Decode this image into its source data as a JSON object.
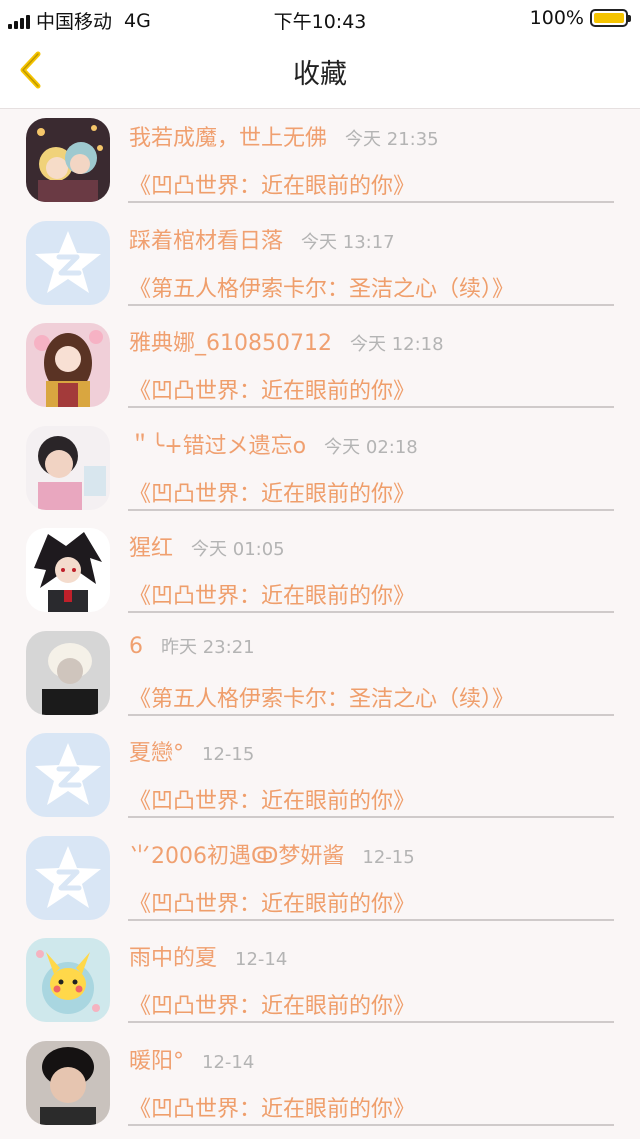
{
  "status_bar": {
    "carrier": "中国移动",
    "network": "4G",
    "time": "下午10:43",
    "battery": "100%",
    "battery_level": 1.0
  },
  "nav": {
    "title": "收藏"
  },
  "colors": {
    "nickname": "#f0a070",
    "book_title": "#ef9e6b",
    "time": "#b4b4b4",
    "back_arrow": "#f5c400"
  },
  "items": [
    {
      "nickname": "我若成魔，世上无佛",
      "time": "今天 21:35",
      "book": "《凹凸世界：近在眼前的你》",
      "avatar": "anime-couple-avatar"
    },
    {
      "nickname": "踩着棺材看日落",
      "time": "今天 13:17",
      "book": "《第五人格伊索卡尔：圣洁之心（续）》",
      "avatar": "default-qq-avatar"
    },
    {
      "nickname": "雅典娜_610850712",
      "time": "今天 12:18",
      "book": "《凹凸世界：近在眼前的你》",
      "avatar": "anime-girl-avatar"
    },
    {
      "nickname": "＂╰+错过メ遗忘o",
      "time": "今天 02:18",
      "book": "《凹凸世界：近在眼前的你》",
      "avatar": "girl-photo-avatar"
    },
    {
      "nickname": "猩红",
      "time": "今天 01:05",
      "book": "《凹凸世界：近在眼前的你》",
      "avatar": "anime-boy-avatar"
    },
    {
      "nickname": "6",
      "time": "昨天 23:21",
      "book": "《第五人格伊索卡尔：圣洁之心（续）》",
      "avatar": "blond-boy-avatar"
    },
    {
      "nickname": "夏戀°",
      "time": "12-15",
      "book": "《凹凸世界：近在眼前的你》",
      "avatar": "default-qq-avatar"
    },
    {
      "nickname": "⺌2006初遇ↂ梦妍酱",
      "time": "12-15",
      "book": "《凹凸世界：近在眼前的你》",
      "avatar": "default-qq-avatar"
    },
    {
      "nickname": "雨中的夏",
      "time": "12-14",
      "book": "《凹凸世界：近在眼前的你》",
      "avatar": "pikachu-avatar"
    },
    {
      "nickname": "暖阳°",
      "time": "12-14",
      "book": "《凹凸世界：近在眼前的你》",
      "avatar": "boy-photo-avatar"
    }
  ]
}
